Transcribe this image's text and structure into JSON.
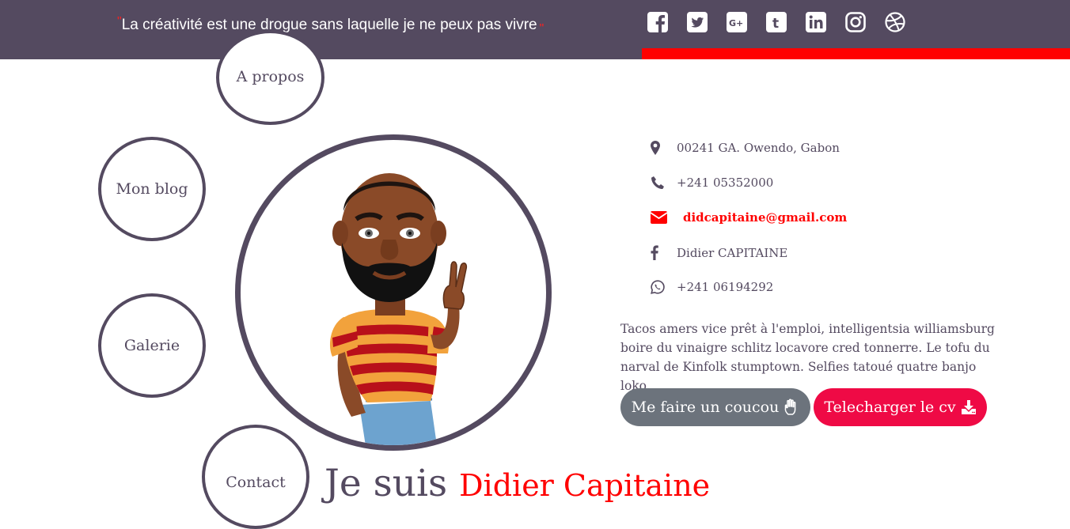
{
  "header": {
    "quote_open": "\"",
    "quote_text": "La créativité est une drogue sans laquelle je ne peux pas vivre",
    "quote_close": "\"",
    "social_icons": [
      "facebook-icon",
      "twitter-icon",
      "google-plus-icon",
      "tumblr-icon",
      "linkedin-icon",
      "instagram-icon",
      "dribbble-icon"
    ]
  },
  "nav": {
    "apropos": "A propos",
    "blog": "Mon blog",
    "galerie": "Galerie",
    "contact": "Contact"
  },
  "hero": {
    "prefix": "Je suis",
    "name": "Didier Capitaine"
  },
  "contact": {
    "address": "00241 GA. Owendo, Gabon",
    "phone": "+241 05352000",
    "email": "didcapitaine@gmail.com",
    "facebook": "Didier CAPITAINE",
    "whatsapp": "+241 06194292"
  },
  "bio": "Tacos amers vice prêt à l'emploi, intelligentsia williamsburg boire du vinaigre schlitz locavore cred tonnerre. Le tofu du narval de Kinfolk stumptown. Selfies tatoué quatre banjo loko.",
  "buttons": {
    "wave": "Me faire un coucou",
    "cv": "Telecharger le cv"
  },
  "colors": {
    "header_bg": "#544a60",
    "accent_red": "#ff0000",
    "cv_button": "#ef0a45",
    "wave_button": "#6c737c",
    "text": "#544a60"
  }
}
